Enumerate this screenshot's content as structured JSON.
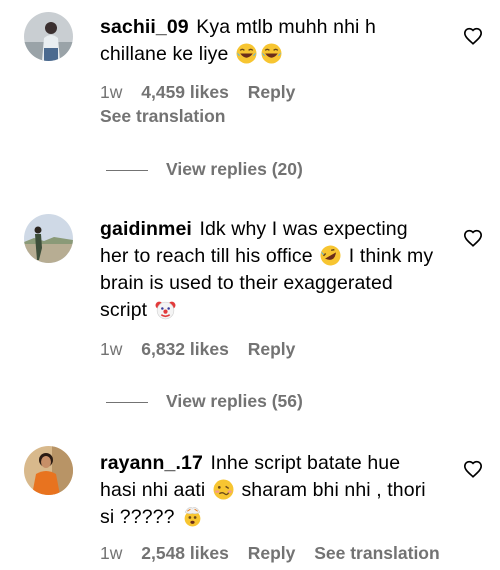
{
  "comments": [
    {
      "username": "sachii_09",
      "text": "Kya mtlb muhh nhi h chillane ke liye",
      "emojis": [
        "laughing-emoji",
        "laughing-emoji"
      ],
      "time": "1w",
      "likes": "4,459 likes",
      "reply": "Reply",
      "see_translation": "See translation",
      "view_replies": "View replies (20)"
    },
    {
      "username": "gaidinmei",
      "text_part1": "Idk why I was expecting her to reach till his office",
      "text_part2": "I think my brain is used to their exaggerated script",
      "emojis": [
        "rofl-emoji",
        "clown-emoji"
      ],
      "time": "1w",
      "likes": "6,832 likes",
      "reply": "Reply",
      "view_replies": "View replies (56)"
    },
    {
      "username": "rayann_.17",
      "text_part1": "Inhe script batate hue hasi nhi aati",
      "text_part2": "sharam bhi nhi , thori si ?????",
      "emojis": [
        "woozy-emoji",
        "exploding-head-emoji"
      ],
      "time": "1w",
      "likes": "2,548 likes",
      "reply": "Reply",
      "see_translation": "See translation"
    }
  ],
  "colors": {
    "text": "#000000",
    "secondary": "#737373",
    "background": "#ffffff"
  }
}
